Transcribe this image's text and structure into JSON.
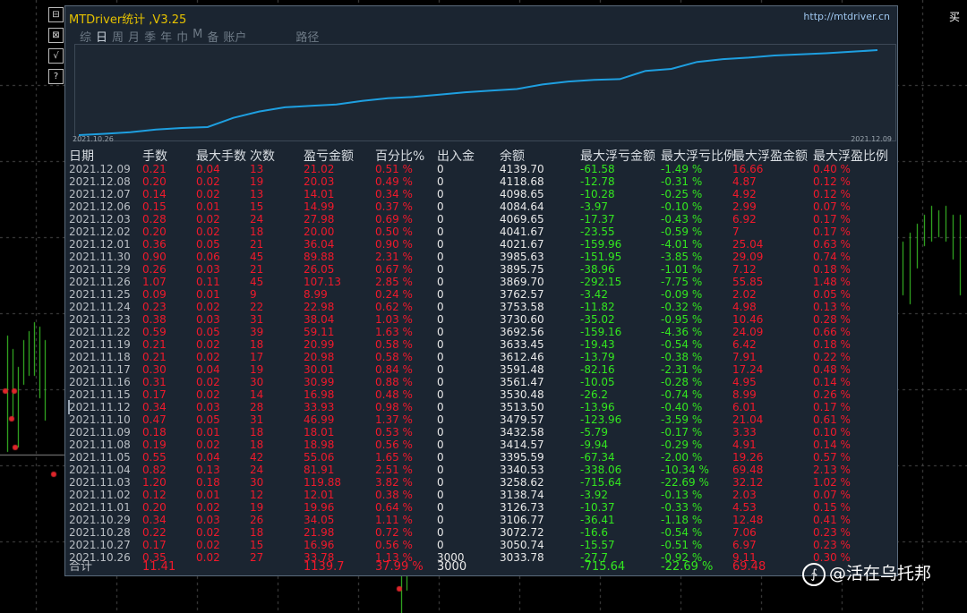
{
  "app": {
    "title": "MTDriver统计 ,V3.25",
    "url": "http://mtdriver.cn",
    "top_right": "买"
  },
  "side_buttons": [
    "⊟",
    "⊠",
    "√",
    "?"
  ],
  "tabs": [
    "综",
    "日",
    "周",
    "月",
    "季",
    "年",
    "巾",
    "M",
    "备",
    "账户",
    "路径"
  ],
  "active_tab": 1,
  "equity_chart": {
    "start_date": "2021.10.26",
    "end_date": "2021.12.09",
    "line_color": "#1e9fe0",
    "values": [
      3033.78,
      3050.74,
      3072.72,
      3106.77,
      3126.73,
      3138.74,
      3258.62,
      3340.53,
      3395.59,
      3414.57,
      3432.58,
      3479.57,
      3513.5,
      3530.48,
      3561.47,
      3591.48,
      3612.46,
      3633.45,
      3692.56,
      3730.6,
      3753.58,
      3762.57,
      3869.7,
      3895.75,
      3985.63,
      4021.67,
      4041.67,
      4069.65,
      4084.64,
      4098.65,
      4118.68,
      4139.7
    ]
  },
  "table": {
    "headers": [
      "日期",
      "手数",
      "最大手数",
      "次数",
      "盈亏金额",
      "百分比%",
      "出入金",
      "余额",
      "最大浮亏金额",
      "最大浮亏比例",
      "最大浮盈金额",
      "最大浮盈比例"
    ],
    "selected_row": 19,
    "rows": [
      [
        "2021.12.09",
        "0.21",
        "0.04",
        "13",
        "21.02",
        "0.51 %",
        "0",
        "4139.70",
        "-61.58",
        "-1.49 %",
        "16.66",
        "0.40 %"
      ],
      [
        "2021.12.08",
        "0.20",
        "0.02",
        "19",
        "20.03",
        "0.49 %",
        "0",
        "4118.68",
        "-12.78",
        "-0.31 %",
        "4.87",
        "0.12 %"
      ],
      [
        "2021.12.07",
        "0.14",
        "0.02",
        "13",
        "14.01",
        "0.34 %",
        "0",
        "4098.65",
        "-10.28",
        "-0.25 %",
        "4.92",
        "0.12 %"
      ],
      [
        "2021.12.06",
        "0.15",
        "0.01",
        "15",
        "14.99",
        "0.37 %",
        "0",
        "4084.64",
        "-3.97",
        "-0.10 %",
        "2.99",
        "0.07 %"
      ],
      [
        "2021.12.03",
        "0.28",
        "0.02",
        "24",
        "27.98",
        "0.69 %",
        "0",
        "4069.65",
        "-17.37",
        "-0.43 %",
        "6.92",
        "0.17 %"
      ],
      [
        "2021.12.02",
        "0.20",
        "0.02",
        "18",
        "20.00",
        "0.50 %",
        "0",
        "4041.67",
        "-23.55",
        "-0.59 %",
        "7",
        "0.17 %"
      ],
      [
        "2021.12.01",
        "0.36",
        "0.05",
        "21",
        "36.04",
        "0.90 %",
        "0",
        "4021.67",
        "-159.96",
        "-4.01 %",
        "25.04",
        "0.63 %"
      ],
      [
        "2021.11.30",
        "0.90",
        "0.06",
        "45",
        "89.88",
        "2.31 %",
        "0",
        "3985.63",
        "-151.95",
        "-3.85 %",
        "29.09",
        "0.74 %"
      ],
      [
        "2021.11.29",
        "0.26",
        "0.03",
        "21",
        "26.05",
        "0.67 %",
        "0",
        "3895.75",
        "-38.96",
        "-1.01 %",
        "7.12",
        "0.18 %"
      ],
      [
        "2021.11.26",
        "1.07",
        "0.11",
        "45",
        "107.13",
        "2.85 %",
        "0",
        "3869.70",
        "-292.15",
        "-7.75 %",
        "55.85",
        "1.48 %"
      ],
      [
        "2021.11.25",
        "0.09",
        "0.01",
        "9",
        "8.99",
        "0.24 %",
        "0",
        "3762.57",
        "-3.42",
        "-0.09 %",
        "2.02",
        "0.05 %"
      ],
      [
        "2021.11.24",
        "0.23",
        "0.02",
        "22",
        "22.98",
        "0.62 %",
        "0",
        "3753.58",
        "-11.82",
        "-0.32 %",
        "4.98",
        "0.13 %"
      ],
      [
        "2021.11.23",
        "0.38",
        "0.03",
        "31",
        "38.04",
        "1.03 %",
        "0",
        "3730.60",
        "-35.02",
        "-0.95 %",
        "10.46",
        "0.28 %"
      ],
      [
        "2021.11.22",
        "0.59",
        "0.05",
        "39",
        "59.11",
        "1.63 %",
        "0",
        "3692.56",
        "-159.16",
        "-4.36 %",
        "24.09",
        "0.66 %"
      ],
      [
        "2021.11.19",
        "0.21",
        "0.02",
        "18",
        "20.99",
        "0.58 %",
        "0",
        "3633.45",
        "-19.43",
        "-0.54 %",
        "6.42",
        "0.18 %"
      ],
      [
        "2021.11.18",
        "0.21",
        "0.02",
        "17",
        "20.98",
        "0.58 %",
        "0",
        "3612.46",
        "-13.79",
        "-0.38 %",
        "7.91",
        "0.22 %"
      ],
      [
        "2021.11.17",
        "0.30",
        "0.04",
        "19",
        "30.01",
        "0.84 %",
        "0",
        "3591.48",
        "-82.16",
        "-2.31 %",
        "17.24",
        "0.48 %"
      ],
      [
        "2021.11.16",
        "0.31",
        "0.02",
        "30",
        "30.99",
        "0.88 %",
        "0",
        "3561.47",
        "-10.05",
        "-0.28 %",
        "4.95",
        "0.14 %"
      ],
      [
        "2021.11.15",
        "0.17",
        "0.02",
        "14",
        "16.98",
        "0.48 %",
        "0",
        "3530.48",
        "-26.2",
        "-0.74 %",
        "8.99",
        "0.26 %"
      ],
      [
        "2021.11.12",
        "0.34",
        "0.03",
        "28",
        "33.93",
        "0.98 %",
        "0",
        "3513.50",
        "-13.96",
        "-0.40 %",
        "6.01",
        "0.17 %"
      ],
      [
        "2021.11.10",
        "0.47",
        "0.05",
        "31",
        "46.99",
        "1.37 %",
        "0",
        "3479.57",
        "-123.96",
        "-3.59 %",
        "21.04",
        "0.61 %"
      ],
      [
        "2021.11.09",
        "0.18",
        "0.01",
        "18",
        "18.01",
        "0.53 %",
        "0",
        "3432.58",
        "-5.79",
        "-0.17 %",
        "3.33",
        "0.10 %"
      ],
      [
        "2021.11.08",
        "0.19",
        "0.02",
        "18",
        "18.98",
        "0.56 %",
        "0",
        "3414.57",
        "-9.94",
        "-0.29 %",
        "4.91",
        "0.14 %"
      ],
      [
        "2021.11.05",
        "0.55",
        "0.04",
        "42",
        "55.06",
        "1.65 %",
        "0",
        "3395.59",
        "-67.34",
        "-2.00 %",
        "19.26",
        "0.57 %"
      ],
      [
        "2021.11.04",
        "0.82",
        "0.13",
        "24",
        "81.91",
        "2.51 %",
        "0",
        "3340.53",
        "-338.06",
        "-10.34 %",
        "69.48",
        "2.13 %"
      ],
      [
        "2021.11.03",
        "1.20",
        "0.18",
        "30",
        "119.88",
        "3.82 %",
        "0",
        "3258.62",
        "-715.64",
        "-22.69 %",
        "32.12",
        "1.02 %"
      ],
      [
        "2021.11.02",
        "0.12",
        "0.01",
        "12",
        "12.01",
        "0.38 %",
        "0",
        "3138.74",
        "-3.92",
        "-0.13 %",
        "2.03",
        "0.07 %"
      ],
      [
        "2021.11.01",
        "0.20",
        "0.02",
        "19",
        "19.96",
        "0.64 %",
        "0",
        "3126.73",
        "-10.37",
        "-0.33 %",
        "4.53",
        "0.15 %"
      ],
      [
        "2021.10.29",
        "0.34",
        "0.03",
        "26",
        "34.05",
        "1.11 %",
        "0",
        "3106.77",
        "-36.41",
        "-1.18 %",
        "12.48",
        "0.41 %"
      ],
      [
        "2021.10.28",
        "0.22",
        "0.02",
        "18",
        "21.98",
        "0.72 %",
        "0",
        "3072.72",
        "-16.6",
        "-0.54 %",
        "7.06",
        "0.23 %"
      ],
      [
        "2021.10.27",
        "0.17",
        "0.02",
        "15",
        "16.96",
        "0.56 %",
        "0",
        "3050.74",
        "-15.57",
        "-0.51 %",
        "6.97",
        "0.23 %"
      ],
      [
        "2021.10.26",
        "0.35",
        "0.02",
        "27",
        "33.78",
        "1.13 %",
        "3000",
        "3033.78",
        "-27.7",
        "-0.92 %",
        "9.11",
        "0.30 %"
      ]
    ],
    "totals": [
      "合计",
      "11.41",
      "",
      "",
      "1139.7",
      "37.99 %",
      "3000",
      "",
      "-715.64",
      "-22.69 %",
      "69.48",
      ""
    ]
  },
  "watermark": "@活在乌托邦",
  "colors": {
    "red": "#f0192b",
    "green": "#33e81f",
    "panel_bg": "#1b2531"
  }
}
